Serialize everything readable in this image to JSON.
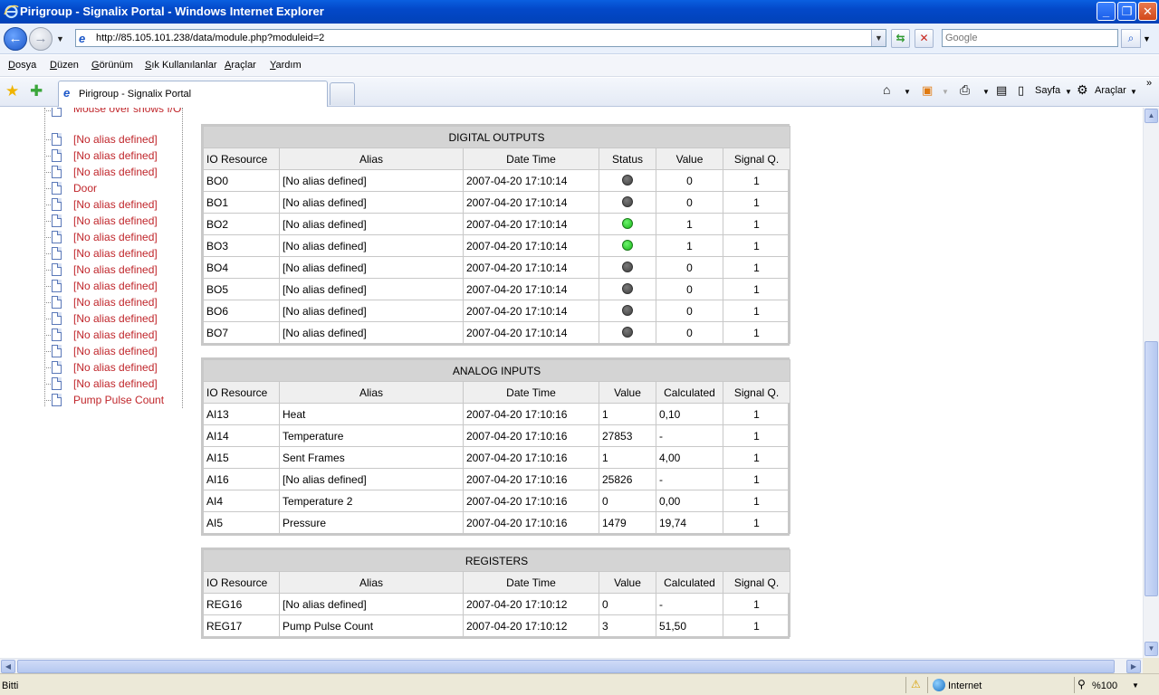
{
  "window": {
    "title": "Pirigroup - Signalix Portal - Windows Internet Explorer"
  },
  "address": {
    "url": "http://85.105.101.238/data/module.php?moduleid=2",
    "search_placeholder": "Google"
  },
  "menu": [
    "Dosya",
    "Düzen",
    "Görünüm",
    "Sık Kullanılanlar",
    "Araçlar",
    "Yardım"
  ],
  "tab": {
    "label": "Pirigroup - Signalix Portal"
  },
  "toolbar": {
    "page_label": "Sayfa",
    "tools_label": "Araçlar"
  },
  "tree": {
    "items": [
      "Mouse over shows I/O",
      "[No alias defined]",
      "[No alias defined]",
      "[No alias defined]",
      "Door",
      "[No alias defined]",
      "[No alias defined]",
      "[No alias defined]",
      "[No alias defined]",
      "[No alias defined]",
      "[No alias defined]",
      "[No alias defined]",
      "[No alias defined]",
      "[No alias defined]",
      "[No alias defined]",
      "[No alias defined]",
      "[No alias defined]",
      "Pump Pulse Count"
    ]
  },
  "digital_outputs": {
    "caption": "DIGITAL OUTPUTS",
    "headers": [
      "IO Resource",
      "Alias",
      "Date Time",
      "Status",
      "Value",
      "Signal Q."
    ],
    "rows": [
      {
        "res": "BO0",
        "alias": "[No alias defined]",
        "dt": "2007-04-20 17:10:14",
        "status": "off",
        "value": "0",
        "sq": "1"
      },
      {
        "res": "BO1",
        "alias": "[No alias defined]",
        "dt": "2007-04-20 17:10:14",
        "status": "off",
        "value": "0",
        "sq": "1"
      },
      {
        "res": "BO2",
        "alias": "[No alias defined]",
        "dt": "2007-04-20 17:10:14",
        "status": "on",
        "value": "1",
        "sq": "1"
      },
      {
        "res": "BO3",
        "alias": "[No alias defined]",
        "dt": "2007-04-20 17:10:14",
        "status": "on",
        "value": "1",
        "sq": "1"
      },
      {
        "res": "BO4",
        "alias": "[No alias defined]",
        "dt": "2007-04-20 17:10:14",
        "status": "off",
        "value": "0",
        "sq": "1"
      },
      {
        "res": "BO5",
        "alias": "[No alias defined]",
        "dt": "2007-04-20 17:10:14",
        "status": "off",
        "value": "0",
        "sq": "1"
      },
      {
        "res": "BO6",
        "alias": "[No alias defined]",
        "dt": "2007-04-20 17:10:14",
        "status": "off",
        "value": "0",
        "sq": "1"
      },
      {
        "res": "BO7",
        "alias": "[No alias defined]",
        "dt": "2007-04-20 17:10:14",
        "status": "off",
        "value": "0",
        "sq": "1"
      }
    ]
  },
  "analog_inputs": {
    "caption": "ANALOG INPUTS",
    "headers": [
      "IO Resource",
      "Alias",
      "Date Time",
      "Value",
      "Calculated",
      "Signal Q."
    ],
    "rows": [
      {
        "res": "AI13",
        "alias": "Heat",
        "dt": "2007-04-20 17:10:16",
        "value": "1",
        "calc": "0,10",
        "sq": "1"
      },
      {
        "res": "AI14",
        "alias": "Temperature",
        "dt": "2007-04-20 17:10:16",
        "value": "27853",
        "calc": "-",
        "sq": "1"
      },
      {
        "res": "AI15",
        "alias": "Sent Frames",
        "dt": "2007-04-20 17:10:16",
        "value": "1",
        "calc": "4,00",
        "sq": "1"
      },
      {
        "res": "AI16",
        "alias": "[No alias defined]",
        "dt": "2007-04-20 17:10:16",
        "value": "25826",
        "calc": "-",
        "sq": "1"
      },
      {
        "res": "AI4",
        "alias": "Temperature 2",
        "dt": "2007-04-20 17:10:16",
        "value": "0",
        "calc": "0,00",
        "sq": "1"
      },
      {
        "res": "AI5",
        "alias": "Pressure",
        "dt": "2007-04-20 17:10:16",
        "value": "1479",
        "calc": "19,74",
        "sq": "1"
      }
    ]
  },
  "registers": {
    "caption": "REGISTERS",
    "headers": [
      "IO Resource",
      "Alias",
      "Date Time",
      "Value",
      "Calculated",
      "Signal Q."
    ],
    "rows": [
      {
        "res": "REG16",
        "alias": "[No alias defined]",
        "dt": "2007-04-20 17:10:12",
        "value": "0",
        "calc": "-",
        "sq": "1"
      },
      {
        "res": "REG17",
        "alias": "Pump Pulse Count",
        "dt": "2007-04-20 17:10:12",
        "value": "3",
        "calc": "51,50",
        "sq": "1"
      }
    ]
  },
  "statusbar": {
    "status": "Bitti",
    "zone": "Internet",
    "zoom": "%100"
  }
}
